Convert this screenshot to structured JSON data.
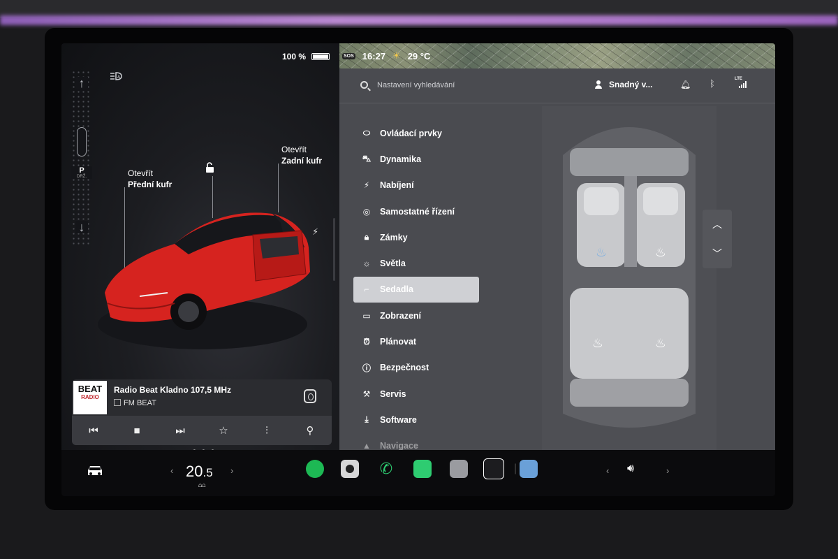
{
  "status_bar": {
    "battery_percent": "100 %",
    "sos": "SOS",
    "time": "16:27",
    "temperature": "29 °C"
  },
  "car_panel": {
    "gear": "P",
    "gear_sub": "DRŽ.",
    "front_trunk": {
      "line1": "Otevřít",
      "line2": "Přední kufr"
    },
    "rear_trunk": {
      "line1": "Otevřít",
      "line2": "Zadní kufr"
    },
    "car_color": "#d6231f"
  },
  "media": {
    "logo_line1": "BEAT",
    "logo_line2": "RADIO",
    "station": "Radio Beat Kladno 107,5 MHz",
    "source": "FM BEAT"
  },
  "settings": {
    "search_placeholder": "Nastavení vyhledávání",
    "user": "Snadný v...",
    "lte": "LTE",
    "menu": [
      {
        "label": "Ovládací prvky",
        "icon": "toggle-icon"
      },
      {
        "label": "Dynamika",
        "icon": "car-icon"
      },
      {
        "label": "Nabíjení",
        "icon": "bolt-icon"
      },
      {
        "label": "Samostatné řízení",
        "icon": "steering-wheel-icon"
      },
      {
        "label": "Zámky",
        "icon": "lock-icon"
      },
      {
        "label": "Světla",
        "icon": "sun-icon"
      },
      {
        "label": "Sedadla",
        "icon": "seat-icon"
      },
      {
        "label": "Zobrazení",
        "icon": "display-icon"
      },
      {
        "label": "Plánovat",
        "icon": "alarm-clock-icon"
      },
      {
        "label": "Bezpečnost",
        "icon": "alert-icon"
      },
      {
        "label": "Servis",
        "icon": "wrench-icon"
      },
      {
        "label": "Software",
        "icon": "download-icon"
      },
      {
        "label": "Navigace",
        "icon": "navigation-icon"
      }
    ],
    "active_item": "Sedadla"
  },
  "dock": {
    "cabin_temp_int": "20",
    "cabin_temp_dec": ".5"
  },
  "colors": {
    "heat_blue": "#7fb0e0",
    "heat_off": "#ffffff",
    "spotify": "#1db954",
    "phone": "#2ecc71"
  }
}
